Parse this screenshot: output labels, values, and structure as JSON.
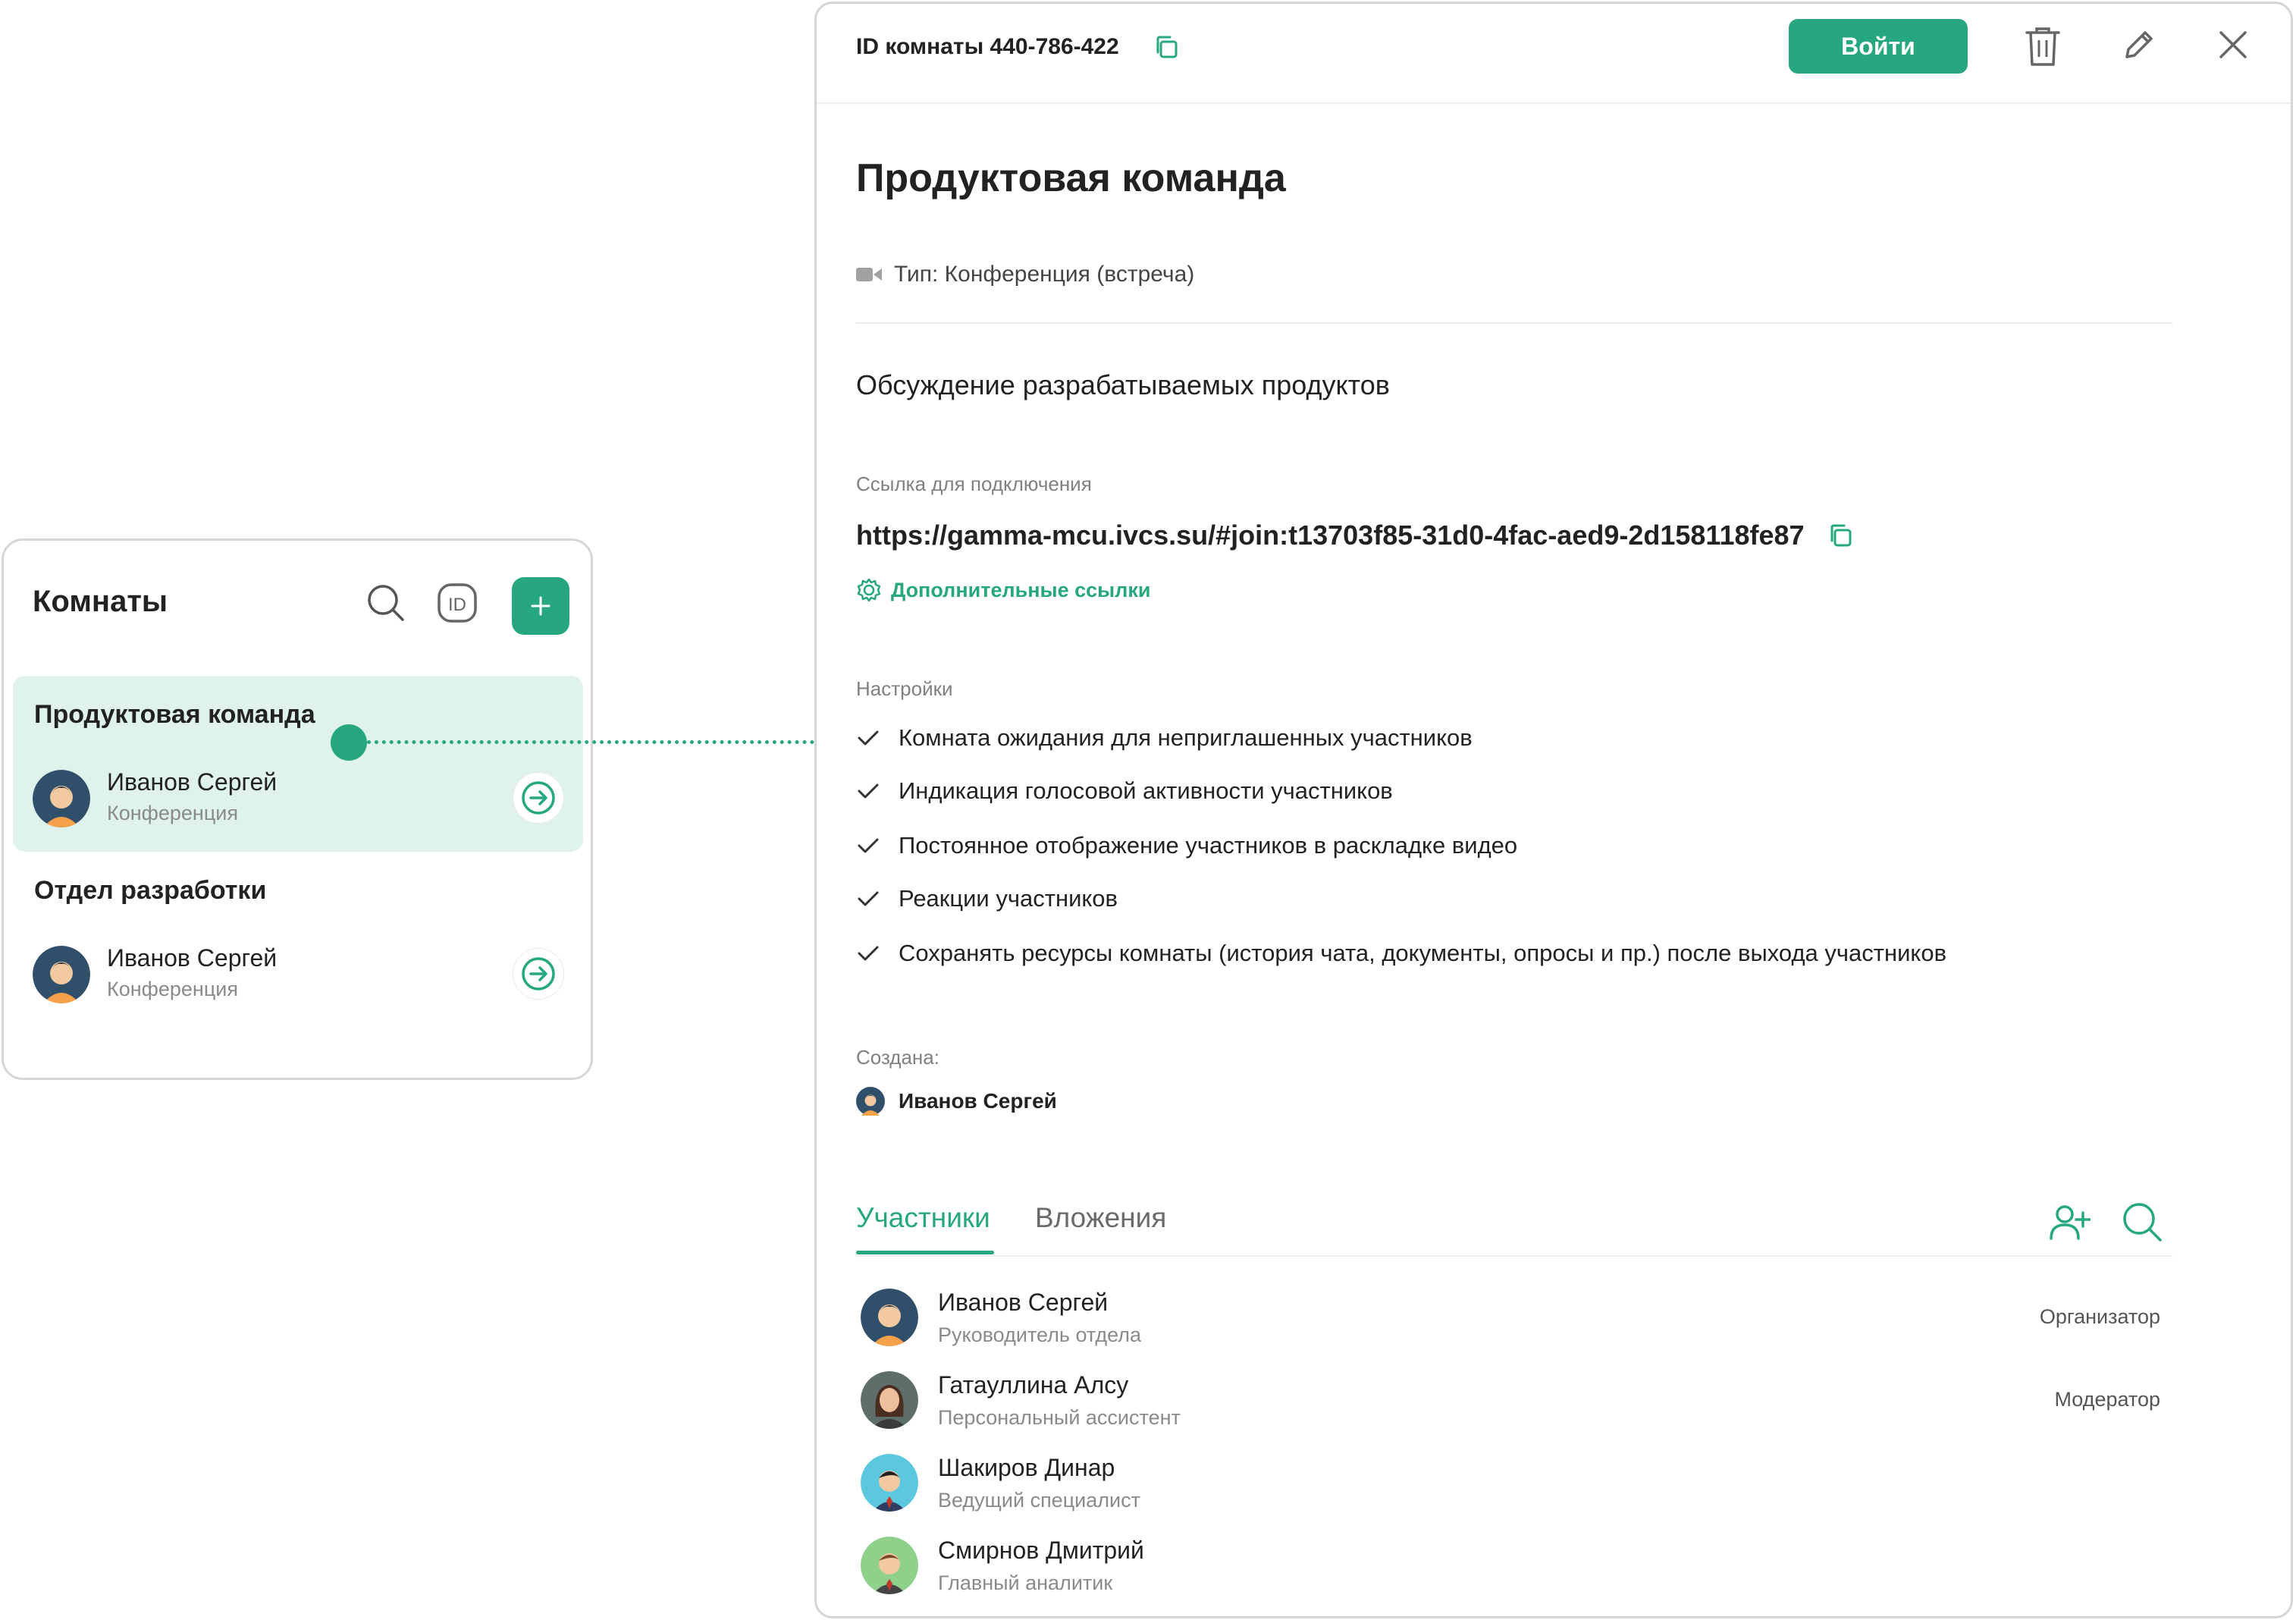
{
  "colors": {
    "accent": "#26a77f",
    "active_bg": "#dff3ec",
    "muted": "#8a8a8a"
  },
  "rooms_panel": {
    "title": "Комнаты",
    "icons": [
      "search-icon",
      "id-icon",
      "plus-icon"
    ],
    "rooms": [
      {
        "name": "Продуктовая команда",
        "owner": "Иванов Сергей",
        "type": "Конференция",
        "active": true
      },
      {
        "name": "Отдел разработки",
        "owner": "Иванов Сергей",
        "type": "Конференция",
        "active": false
      }
    ]
  },
  "detail": {
    "room_id": "ID комнаты 440-786-422",
    "enter_label": "Войти",
    "title": "Продуктовая команда",
    "type": "Тип: Конференция (встреча)",
    "description": "Обсуждение разрабатываемых продуктов",
    "link_label": "Ссылка для подключения",
    "link_url": "https://gamma-mcu.ivcs.su/#join:t13703f85-31d0-4fac-aed9-2d158118fe87",
    "extra_links": "Дополнительные ссылки",
    "settings_label": "Настройки",
    "settings": [
      "Комната ожидания для неприглашенных участников",
      "Индикация голосовой активности участников",
      "Постоянное отображение участников в раскладке видео",
      "Реакции участников",
      "Сохранять ресурсы комнаты (история чата, документы, опросы и пр.) после выхода участников"
    ],
    "created_label": "Создана:",
    "created_by": "Иванов Сергей",
    "tabs": [
      {
        "label": "Участники",
        "active": true
      },
      {
        "label": "Вложения",
        "active": false
      }
    ],
    "participants": [
      {
        "name": "Иванов Сергей",
        "role": "Руководитель отдела",
        "status": "Организатор"
      },
      {
        "name": "Гатауллина Алсу",
        "role": "Персональный ассистент",
        "status": "Модератор"
      },
      {
        "name": "Шакиров Динар",
        "role": "Ведущий специалист",
        "status": ""
      },
      {
        "name": "Смирнов Дмитрий",
        "role": "Главный аналитик",
        "status": ""
      }
    ]
  }
}
